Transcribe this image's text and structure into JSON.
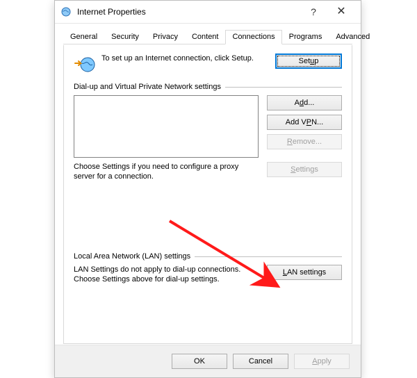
{
  "window": {
    "title": "Internet Properties",
    "help": "?",
    "close": "✕"
  },
  "tabs": {
    "general": "General",
    "security": "Security",
    "privacy": "Privacy",
    "content": "Content",
    "connections": "Connections",
    "programs": "Programs",
    "advanced": "Advanced"
  },
  "intro": {
    "text": "To set up an Internet connection, click Setup.",
    "setup_btn": "Setup"
  },
  "dialup": {
    "group": "Dial-up and Virtual Private Network settings",
    "add_btn": "Add...",
    "add_vpn_btn": "Add VPN...",
    "remove_btn": "Remove...",
    "proxy_text": "Choose Settings if you need to configure a proxy server for a connection.",
    "settings_btn": "Settings"
  },
  "lan": {
    "group": "Local Area Network (LAN) settings",
    "text": "LAN Settings do not apply to dial-up connections. Choose Settings above for dial-up settings.",
    "btn": "LAN settings"
  },
  "footer": {
    "ok": "OK",
    "cancel": "Cancel",
    "apply": "Apply"
  }
}
